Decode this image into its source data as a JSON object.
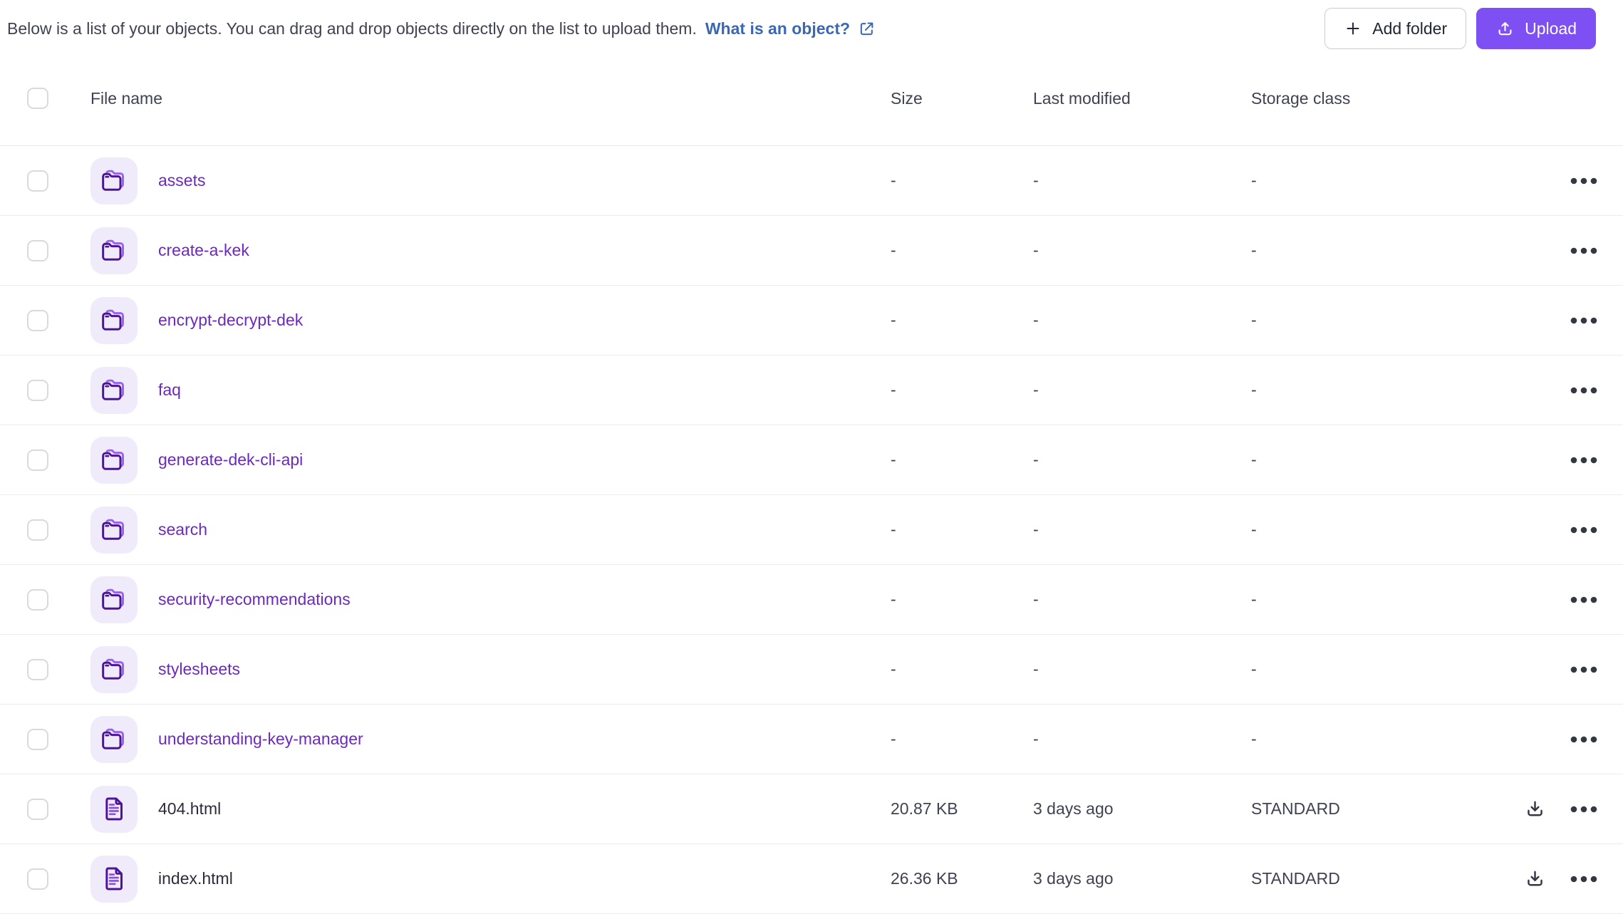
{
  "page": {
    "description": "Below is a list of your objects. You can drag and drop objects directly on the list to upload them.",
    "help_link": "What is an object?",
    "buttons": {
      "add_folder": "Add folder",
      "upload": "Upload"
    }
  },
  "table": {
    "headers": {
      "name": "File name",
      "size": "Size",
      "modified": "Last modified",
      "storage": "Storage class"
    },
    "rows": [
      {
        "name": "assets",
        "type": "folder",
        "size": "-",
        "modified": "-",
        "storage": "-"
      },
      {
        "name": "create-a-kek",
        "type": "folder",
        "size": "-",
        "modified": "-",
        "storage": "-"
      },
      {
        "name": "encrypt-decrypt-dek",
        "type": "folder",
        "size": "-",
        "modified": "-",
        "storage": "-"
      },
      {
        "name": "faq",
        "type": "folder",
        "size": "-",
        "modified": "-",
        "storage": "-"
      },
      {
        "name": "generate-dek-cli-api",
        "type": "folder",
        "size": "-",
        "modified": "-",
        "storage": "-"
      },
      {
        "name": "search",
        "type": "folder",
        "size": "-",
        "modified": "-",
        "storage": "-"
      },
      {
        "name": "security-recommendations",
        "type": "folder",
        "size": "-",
        "modified": "-",
        "storage": "-"
      },
      {
        "name": "stylesheets",
        "type": "folder",
        "size": "-",
        "modified": "-",
        "storage": "-"
      },
      {
        "name": "understanding-key-manager",
        "type": "folder",
        "size": "-",
        "modified": "-",
        "storage": "-"
      },
      {
        "name": "404.html",
        "type": "file",
        "size": "20.87 KB",
        "modified": "3 days ago",
        "storage": "STANDARD"
      },
      {
        "name": "index.html",
        "type": "file",
        "size": "26.36 KB",
        "modified": "3 days ago",
        "storage": "STANDARD"
      }
    ]
  },
  "icons": {
    "plus": "plus-icon",
    "upload": "upload-icon",
    "external_link": "external-link-icon",
    "folder": "folder-icon",
    "file": "file-icon",
    "download": "download-icon",
    "row_menu": "ellipsis-icon"
  },
  "colors": {
    "accent_purple": "#7E4FF3",
    "link_blue": "#3A68B4",
    "folder_link": "#6B29BE",
    "icon_dark": "#4D1499",
    "icon_light": "#9A63EE",
    "icon_bg": "#F0EBFB",
    "text_dark": "#3F4250",
    "divider": "#ECECF0"
  }
}
